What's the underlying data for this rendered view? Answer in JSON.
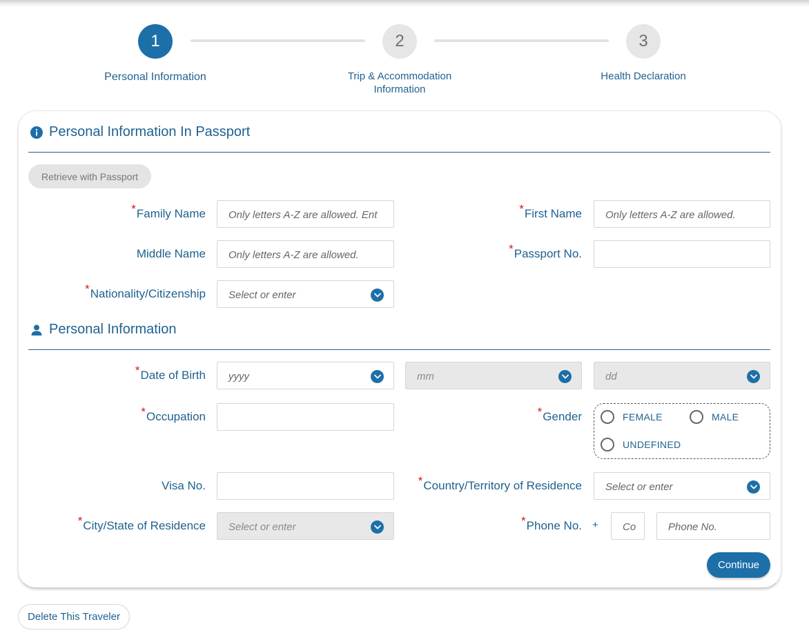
{
  "stepper": {
    "steps": [
      {
        "number": "1",
        "label": "Personal Information",
        "state": "active"
      },
      {
        "number": "2",
        "label_line1": "Trip & Accommodation",
        "label_line2": "Information",
        "state": "inactive"
      },
      {
        "number": "3",
        "label": "Health Declaration",
        "state": "inactive"
      }
    ]
  },
  "passport_section": {
    "title": "Personal Information In Passport",
    "icon": "info-icon",
    "retrieve_button": "Retrieve with Passport",
    "fields": {
      "family_name": {
        "label": "Family Name",
        "required": true,
        "placeholder": "Only letters A-Z are allowed. Ent"
      },
      "first_name": {
        "label": "First Name",
        "required": true,
        "placeholder": "Only letters A-Z are allowed."
      },
      "middle_name": {
        "label": "Middle Name",
        "required": false,
        "placeholder": "Only letters A-Z are allowed."
      },
      "passport_no": {
        "label": "Passport No.",
        "required": true,
        "placeholder": ""
      },
      "nationality": {
        "label": "Nationality/Citizenship",
        "required": true,
        "placeholder": "Select or enter"
      }
    }
  },
  "personal_section": {
    "title": "Personal Information",
    "icon": "person-icon",
    "fields": {
      "date_of_birth": {
        "label": "Date of Birth",
        "required": true,
        "year_placeholder": "yyyy",
        "month_placeholder": "mm",
        "day_placeholder": "dd"
      },
      "occupation": {
        "label": "Occupation",
        "required": true,
        "value": ""
      },
      "gender": {
        "label": "Gender",
        "required": true,
        "options": [
          "FEMALE",
          "MALE",
          "UNDEFINED"
        ]
      },
      "visa_no": {
        "label": "Visa No.",
        "required": false,
        "value": ""
      },
      "country_residence": {
        "label": "Country/Territory of Residence",
        "required": true,
        "placeholder": "Select or enter"
      },
      "city_residence": {
        "label": "City/State of Residence",
        "required": true,
        "placeholder": "Select or enter"
      },
      "phone": {
        "label": "Phone No.",
        "required": true,
        "prefix": "+",
        "code_placeholder": "Co",
        "number_placeholder": "Phone No."
      }
    }
  },
  "actions": {
    "continue": "Continue",
    "delete_traveler": "Delete This Traveler"
  },
  "colors": {
    "primary": "#1d6fa8",
    "text": "#1f6190",
    "required": "#d11a1a",
    "disabled_bg": "#e8e8e8"
  }
}
